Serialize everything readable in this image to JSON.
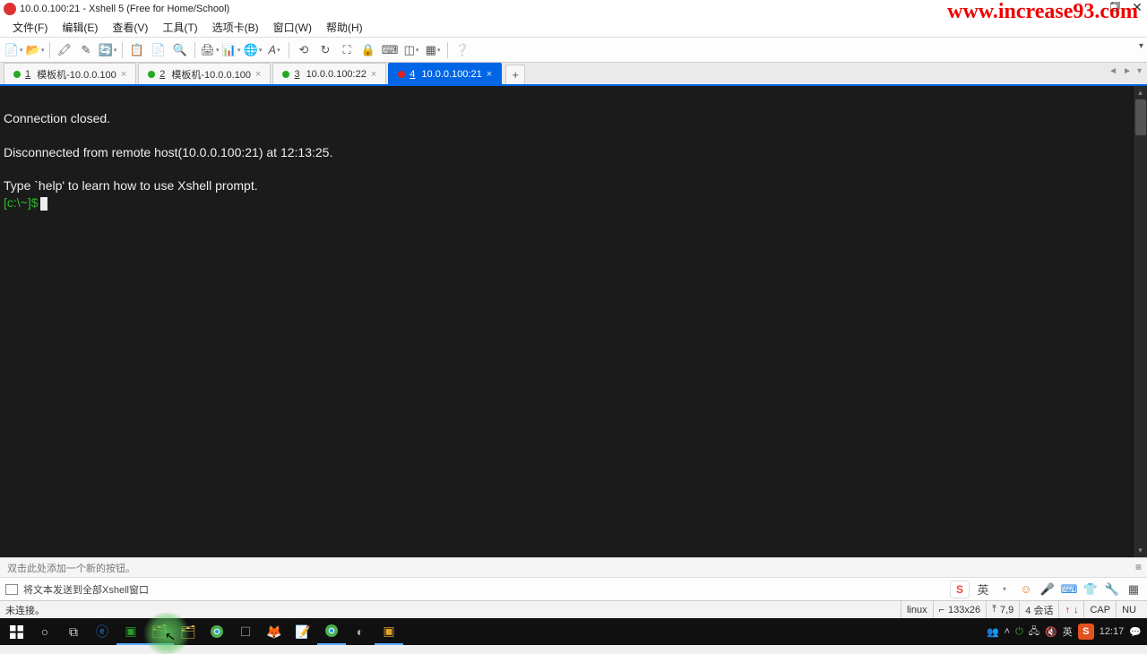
{
  "watermark": "www.increase93.com",
  "window": {
    "title": "10.0.0.100:21 - Xshell 5 (Free for Home/School)"
  },
  "menu": {
    "file": "文件(F)",
    "edit": "编辑(E)",
    "view": "查看(V)",
    "tools": "工具(T)",
    "tabs": "选项卡(B)",
    "window": "窗口(W)",
    "help": "帮助(H)"
  },
  "tabs": [
    {
      "num": "1",
      "label": "模板机-10.0.0.100",
      "status": "green",
      "active": false
    },
    {
      "num": "2",
      "label": "模板机-10.0.0.100",
      "status": "green",
      "active": false
    },
    {
      "num": "3",
      "label": "10.0.0.100:22",
      "status": "green",
      "active": false
    },
    {
      "num": "4",
      "label": "10.0.0.100:21",
      "status": "red",
      "active": true
    }
  ],
  "terminal": {
    "line1": "Connection closed.",
    "line2": "Disconnected from remote host(10.0.0.100:21) at 12:13:25.",
    "line3": "Type `help' to learn how to use Xshell prompt.",
    "prompt": "[c:\\~]$"
  },
  "compose": {
    "hint": "双击此处添加一个新的按钮。",
    "send_label": "将文本发送到全部Xshell窗口"
  },
  "send_right": {
    "lang": "英"
  },
  "status": {
    "left": "未连接。",
    "os": "linux",
    "size": "133x26",
    "cursor": "7,9",
    "sessions": "4 会话",
    "caps": "CAP",
    "num": "NU"
  },
  "taskbar": {
    "ime": "英",
    "time": "12:17"
  },
  "size_sym": "⌐",
  "cur_sym": "⤒"
}
